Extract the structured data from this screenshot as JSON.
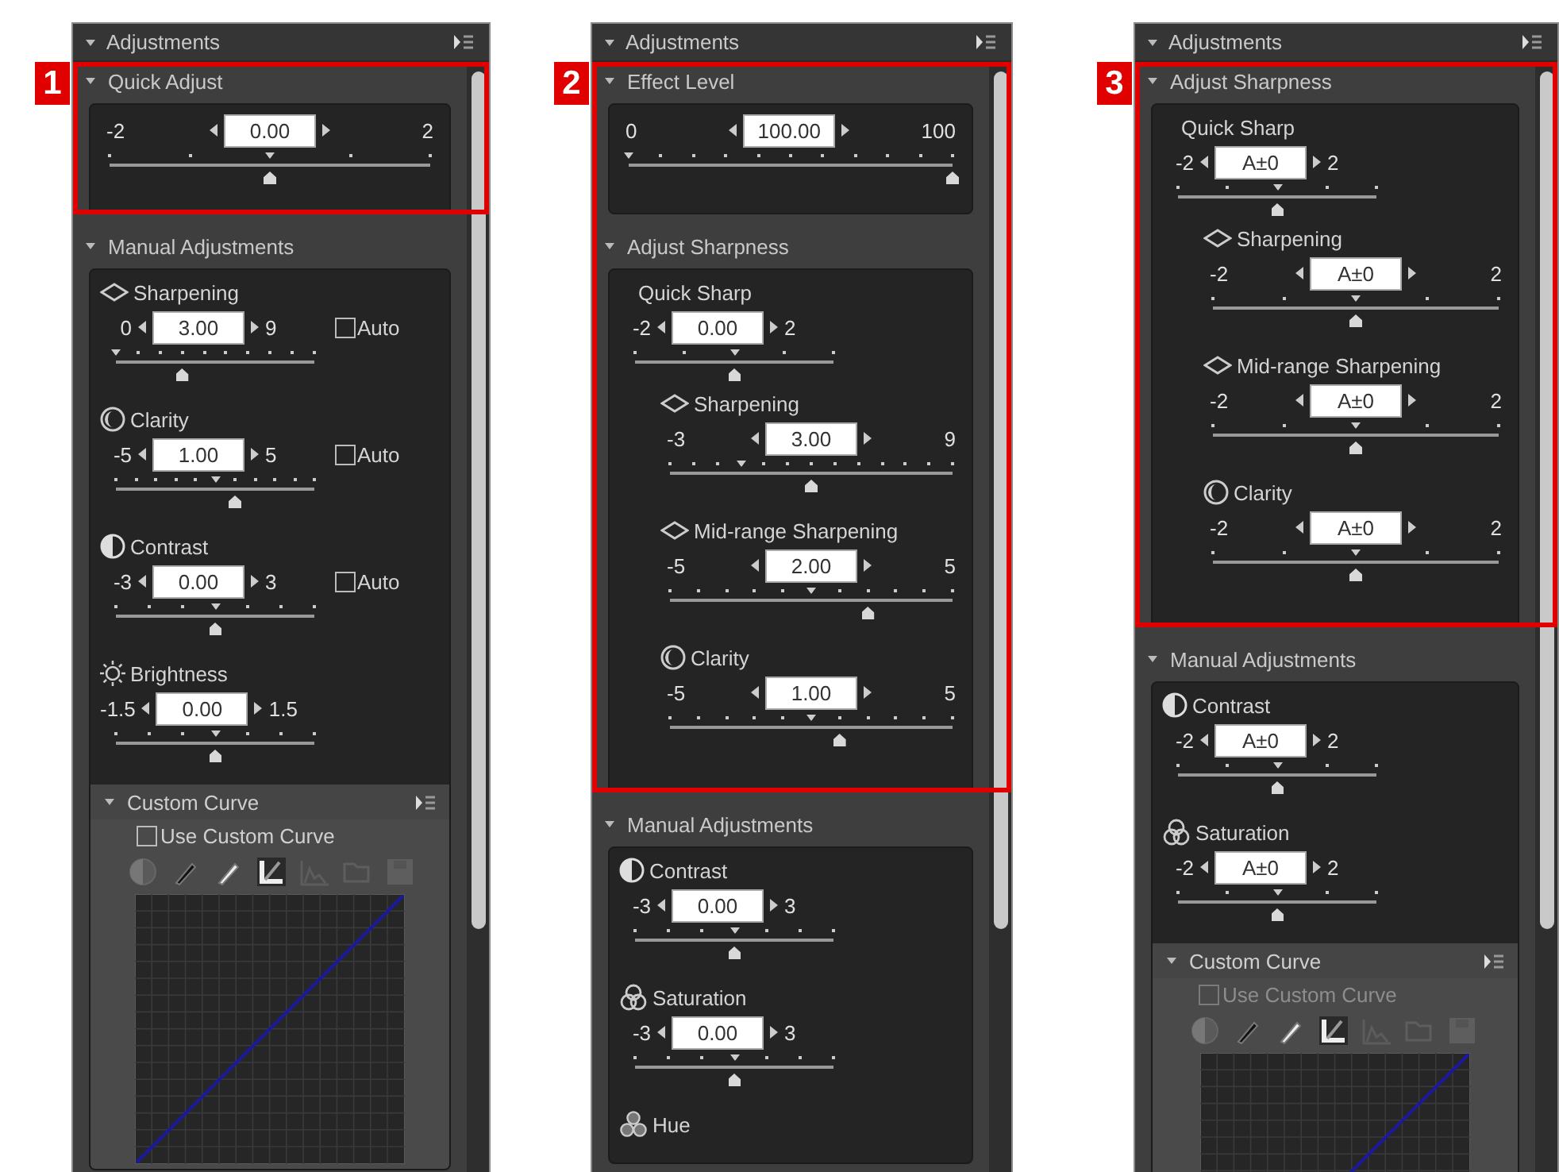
{
  "panels": [
    {
      "callout": "1",
      "title": "Adjustments",
      "sections": [
        {
          "title": "Quick Adjust",
          "highlighted": true,
          "items": [
            {
              "kind": "plain",
              "min": "-2",
              "max": "2",
              "value": "0.00",
              "level": 0.5
            }
          ]
        },
        {
          "title": "Manual Adjustments",
          "highlighted": false,
          "items": [
            {
              "kind": "sharpening",
              "label": "Sharpening",
              "min": "0",
              "max": "9",
              "value": "3.00",
              "level": 0.333,
              "auto": {
                "label": "Auto",
                "checked": false
              }
            },
            {
              "kind": "clarity",
              "label": "Clarity",
              "min": "-5",
              "max": "5",
              "value": "1.00",
              "level": 0.6,
              "auto": {
                "label": "Auto",
                "checked": false
              }
            },
            {
              "kind": "contrast",
              "label": "Contrast",
              "min": "-3",
              "max": "3",
              "value": "0.00",
              "level": 0.5,
              "auto": {
                "label": "Auto",
                "checked": false
              }
            },
            {
              "kind": "brightness",
              "label": "Brightness",
              "min": "-1.5",
              "max": "1.5",
              "value": "0.00",
              "level": 0.5
            },
            {
              "kind": "curve",
              "title": "Custom Curve",
              "checkbox": {
                "label": "Use Custom Curve",
                "checked": false,
                "disabled": false
              }
            }
          ]
        }
      ]
    },
    {
      "callout": "2",
      "title": "Adjustments",
      "sections": [
        {
          "title": "Effect Level",
          "highlighted": true,
          "items": [
            {
              "kind": "plain",
              "min": "0",
              "max": "100",
              "value": "100.00",
              "level": 1
            }
          ]
        },
        {
          "title": "Adjust Sharpness",
          "highlighted": true,
          "items": [
            {
              "kind": "plain",
              "label": "Quick Sharp",
              "min": "-2",
              "max": "2",
              "value": "0.00",
              "level": 0.5,
              "children": [
                {
                  "kind": "sharpening",
                  "label": "Sharpening",
                  "min": "-3",
                  "max": "9",
                  "value": "3.00",
                  "level": 0.5
                },
                {
                  "kind": "sharpening",
                  "label": "Mid-range Sharpening",
                  "min": "-5",
                  "max": "5",
                  "value": "2.00",
                  "level": 0.7
                },
                {
                  "kind": "clarity",
                  "label": "Clarity",
                  "min": "-5",
                  "max": "5",
                  "value": "1.00",
                  "level": 0.6
                }
              ]
            }
          ]
        },
        {
          "title": "Manual Adjustments",
          "highlighted": false,
          "items": [
            {
              "kind": "contrast",
              "label": "Contrast",
              "min": "-3",
              "max": "3",
              "value": "0.00",
              "level": 0.5
            },
            {
              "kind": "saturation",
              "label": "Saturation",
              "min": "-3",
              "max": "3",
              "value": "0.00",
              "level": 0.5
            },
            {
              "kind": "hue",
              "label": "Hue"
            }
          ]
        }
      ]
    },
    {
      "callout": "3",
      "title": "Adjustments",
      "sections": [
        {
          "title": "Adjust Sharpness",
          "highlighted": true,
          "items": [
            {
              "kind": "plain",
              "label": "Quick Sharp",
              "min": "-2",
              "max": "2",
              "value": "A±0",
              "level": 0.5,
              "children": [
                {
                  "kind": "sharpening",
                  "label": "Sharpening",
                  "min": "-2",
                  "max": "2",
                  "value": "A±0",
                  "level": 0.5
                },
                {
                  "kind": "sharpening",
                  "label": "Mid-range Sharpening",
                  "min": "-2",
                  "max": "2",
                  "value": "A±0",
                  "level": 0.5
                },
                {
                  "kind": "clarity",
                  "label": "Clarity",
                  "min": "-2",
                  "max": "2",
                  "value": "A±0",
                  "level": 0.5
                }
              ]
            }
          ]
        },
        {
          "title": "Manual Adjustments",
          "highlighted": false,
          "items": [
            {
              "kind": "contrast",
              "label": "Contrast",
              "min": "-2",
              "max": "2",
              "value": "A±0",
              "level": 0.5
            },
            {
              "kind": "saturation",
              "label": "Saturation",
              "min": "-2",
              "max": "2",
              "value": "A±0",
              "level": 0.5
            },
            {
              "kind": "curve",
              "title": "Custom Curve",
              "checkbox": {
                "label": "Use Custom Curve",
                "checked": false,
                "disabled": true
              }
            }
          ]
        }
      ]
    }
  ]
}
